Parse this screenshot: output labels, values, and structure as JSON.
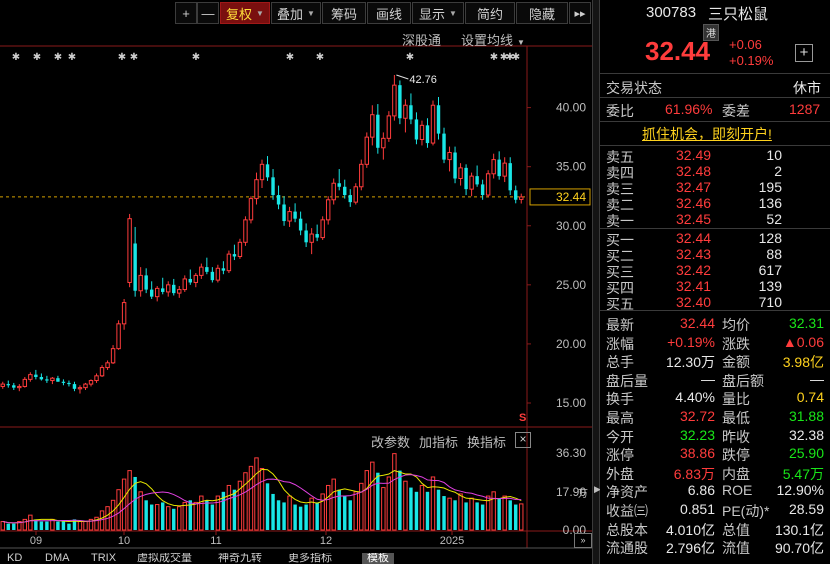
{
  "toolbar": {
    "buttons": [
      "+",
      "—",
      "复权",
      "叠加",
      "筹码",
      "画线",
      "显示",
      "简约",
      "隐藏"
    ],
    "more": "▸▸",
    "sub_links": [
      "深股通",
      "设置均线"
    ]
  },
  "chart_data": [
    {
      "type": "candlestick",
      "title": "",
      "x_tick_labels": [
        "09",
        "10",
        "11",
        "12",
        "2025"
      ],
      "y_ticks": [
        "40.00",
        "35.00",
        "30.00",
        "25.00",
        "20.00",
        "15.00"
      ],
      "ylim": [
        15,
        42.76
      ],
      "current_price_label": "32.44",
      "max_annotation": "42.76",
      "candles": [
        [
          16.4,
          16.8,
          16.2,
          16.6
        ],
        [
          16.6,
          16.9,
          16.3,
          16.5
        ],
        [
          16.5,
          16.7,
          16.1,
          16.3
        ],
        [
          16.3,
          16.6,
          16.0,
          16.4
        ],
        [
          16.4,
          17.2,
          16.3,
          17.0
        ],
        [
          17.0,
          17.6,
          16.8,
          17.4
        ],
        [
          17.4,
          17.8,
          17.0,
          17.2
        ],
        [
          17.2,
          17.5,
          16.9,
          17.0
        ],
        [
          17.0,
          17.3,
          16.7,
          16.9
        ],
        [
          16.9,
          17.2,
          16.6,
          17.1
        ],
        [
          17.1,
          17.3,
          16.8,
          16.8
        ],
        [
          16.8,
          17.0,
          16.5,
          16.7
        ],
        [
          16.7,
          16.9,
          16.4,
          16.6
        ],
        [
          16.6,
          16.8,
          16.0,
          16.2
        ],
        [
          16.2,
          16.5,
          15.8,
          16.3
        ],
        [
          16.3,
          16.7,
          16.1,
          16.6
        ],
        [
          16.6,
          17.0,
          16.4,
          16.9
        ],
        [
          16.9,
          17.5,
          16.7,
          17.3
        ],
        [
          17.3,
          18.2,
          17.2,
          18.0
        ],
        [
          18.0,
          18.6,
          17.8,
          18.4
        ],
        [
          18.4,
          19.9,
          18.3,
          19.6
        ],
        [
          19.6,
          22.0,
          19.5,
          21.7
        ],
        [
          21.7,
          23.8,
          21.2,
          23.5
        ],
        [
          25.2,
          31.0,
          24.8,
          30.6
        ],
        [
          28.5,
          29.9,
          24.0,
          24.5
        ],
        [
          24.5,
          26.5,
          24.0,
          25.8
        ],
        [
          25.8,
          26.4,
          24.3,
          24.6
        ],
        [
          24.6,
          25.3,
          23.8,
          24.0
        ],
        [
          24.0,
          24.9,
          23.6,
          24.7
        ],
        [
          24.7,
          25.6,
          24.2,
          24.4
        ],
        [
          24.4,
          25.3,
          24.0,
          25.0
        ],
        [
          25.0,
          25.5,
          24.1,
          24.3
        ],
        [
          24.3,
          24.9,
          23.9,
          24.6
        ],
        [
          24.6,
          25.8,
          24.4,
          25.5
        ],
        [
          25.5,
          26.3,
          25.0,
          25.2
        ],
        [
          25.2,
          26.0,
          24.8,
          25.8
        ],
        [
          25.8,
          26.8,
          25.5,
          26.5
        ],
        [
          26.5,
          27.3,
          25.9,
          26.1
        ],
        [
          26.1,
          26.5,
          25.2,
          25.4
        ],
        [
          25.4,
          26.7,
          25.2,
          26.4
        ],
        [
          26.4,
          27.0,
          25.9,
          26.2
        ],
        [
          26.2,
          27.9,
          26.0,
          27.6
        ],
        [
          27.6,
          28.4,
          27.1,
          27.4
        ],
        [
          27.4,
          28.9,
          27.2,
          28.6
        ],
        [
          28.6,
          30.8,
          28.3,
          30.5
        ],
        [
          30.5,
          32.5,
          30.2,
          32.3
        ],
        [
          32.3,
          34.5,
          31.8,
          33.9
        ],
        [
          33.9,
          35.6,
          33.2,
          35.2
        ],
        [
          35.2,
          35.9,
          33.8,
          34.1
        ],
        [
          34.1,
          34.8,
          32.2,
          32.6
        ],
        [
          32.6,
          33.4,
          31.4,
          31.8
        ],
        [
          31.8,
          32.5,
          30.0,
          30.4
        ],
        [
          30.4,
          31.6,
          29.9,
          31.2
        ],
        [
          31.2,
          31.9,
          30.3,
          30.6
        ],
        [
          30.6,
          31.2,
          29.2,
          29.6
        ],
        [
          29.6,
          30.2,
          28.2,
          28.6
        ],
        [
          28.6,
          29.8,
          27.6,
          29.3
        ],
        [
          29.3,
          30.1,
          28.7,
          29.0
        ],
        [
          29.0,
          30.8,
          28.8,
          30.5
        ],
        [
          30.5,
          32.5,
          30.1,
          32.2
        ],
        [
          32.2,
          34.0,
          31.8,
          33.6
        ],
        [
          33.6,
          34.8,
          33.0,
          33.3
        ],
        [
          33.3,
          33.9,
          32.3,
          32.6
        ],
        [
          32.6,
          33.1,
          31.6,
          32.0
        ],
        [
          32.0,
          33.6,
          31.8,
          33.3
        ],
        [
          33.3,
          35.6,
          33.0,
          35.2
        ],
        [
          35.2,
          37.9,
          34.9,
          37.5
        ],
        [
          37.5,
          40.2,
          36.8,
          39.4
        ],
        [
          39.4,
          40.3,
          36.1,
          36.6
        ],
        [
          36.6,
          37.9,
          35.6,
          37.4
        ],
        [
          37.4,
          39.7,
          37.1,
          39.3
        ],
        [
          39.3,
          42.76,
          38.9,
          41.9
        ],
        [
          41.9,
          42.3,
          38.6,
          39.1
        ],
        [
          39.1,
          40.7,
          37.9,
          40.2
        ],
        [
          40.2,
          41.2,
          38.6,
          39.0
        ],
        [
          39.0,
          39.6,
          36.9,
          37.3
        ],
        [
          37.3,
          38.9,
          36.8,
          38.5
        ],
        [
          38.5,
          39.1,
          36.6,
          37.0
        ],
        [
          37.0,
          40.6,
          36.8,
          40.2
        ],
        [
          40.2,
          40.9,
          37.3,
          37.8
        ],
        [
          37.8,
          38.3,
          35.3,
          35.6
        ],
        [
          35.6,
          36.7,
          34.6,
          36.2
        ],
        [
          36.2,
          36.7,
          33.6,
          34.0
        ],
        [
          34.0,
          35.3,
          33.4,
          34.9
        ],
        [
          34.9,
          35.2,
          32.6,
          33.1
        ],
        [
          33.1,
          34.5,
          32.5,
          34.2
        ],
        [
          34.2,
          35.1,
          33.3,
          33.5
        ],
        [
          33.5,
          33.9,
          32.2,
          32.6
        ],
        [
          32.6,
          34.7,
          32.4,
          34.4
        ],
        [
          34.4,
          36.1,
          34.0,
          35.6
        ],
        [
          35.6,
          36.3,
          33.9,
          34.2
        ],
        [
          34.2,
          35.8,
          33.7,
          35.3
        ],
        [
          35.3,
          35.8,
          32.6,
          33.0
        ],
        [
          33.0,
          33.4,
          31.9,
          32.2
        ],
        [
          32.23,
          32.72,
          31.88,
          32.44
        ]
      ],
      "volume_y_ticks": [
        "36.30",
        "17.90",
        "0.00"
      ],
      "volume_unit_label": "万",
      "volume_values": [
        4,
        3,
        3,
        4,
        5,
        7,
        5,
        4,
        4,
        5,
        4,
        4,
        3,
        5,
        4,
        4,
        5,
        6,
        9,
        11,
        14,
        19,
        24,
        28,
        25,
        18,
        14,
        12,
        12,
        13,
        11,
        10,
        11,
        13,
        14,
        13,
        16,
        14,
        12,
        16,
        18,
        21,
        19,
        23,
        27,
        30,
        34,
        29,
        22,
        17,
        14,
        13,
        16,
        12,
        11,
        12,
        15,
        13,
        17,
        21,
        24,
        19,
        16,
        14,
        18,
        22,
        28,
        32,
        27,
        20,
        25,
        36,
        28,
        23,
        20,
        18,
        21,
        18,
        25,
        19,
        16,
        15,
        14,
        17,
        13,
        15,
        13,
        12,
        16,
        18,
        15,
        16,
        14,
        12,
        12.3
      ]
    }
  ],
  "indicator_bar": {
    "labels": [
      "改参数",
      "加指标",
      "换指标"
    ],
    "close": "×"
  },
  "bottom_tabs": [
    "KD",
    "DMA",
    "TRIX",
    "虚拟成交量",
    "神奇九转",
    "更多指标",
    "模板"
  ],
  "bottom_tabs_active": 6,
  "stock": {
    "code": "300783",
    "name": "三只松鼠",
    "market_badge": "港",
    "price": "32.44",
    "change": "+0.06",
    "change_pct": "+0.19%",
    "add_btn": "+"
  },
  "status": {
    "label": "交易状态",
    "value": "休市"
  },
  "commission": {
    "ratio_label": "委比",
    "ratio": "61.96%",
    "diff_label": "委差",
    "diff": "1287"
  },
  "promo": "抓住机会，即刻开户!",
  "asks": [
    {
      "label": "卖五",
      "price": "32.49",
      "vol": "10"
    },
    {
      "label": "卖四",
      "price": "32.48",
      "vol": "2"
    },
    {
      "label": "卖三",
      "price": "32.47",
      "vol": "195"
    },
    {
      "label": "卖二",
      "price": "32.46",
      "vol": "136"
    },
    {
      "label": "卖一",
      "price": "32.45",
      "vol": "52"
    }
  ],
  "bids": [
    {
      "label": "买一",
      "price": "32.44",
      "vol": "128"
    },
    {
      "label": "买二",
      "price": "32.43",
      "vol": "88"
    },
    {
      "label": "买三",
      "price": "32.42",
      "vol": "617"
    },
    {
      "label": "买四",
      "price": "32.41",
      "vol": "139"
    },
    {
      "label": "买五",
      "price": "32.40",
      "vol": "710"
    }
  ],
  "stats": [
    {
      "l1": "最新",
      "v1": "32.44",
      "c1": "red",
      "l2": "均价",
      "v2": "32.31",
      "c2": "green"
    },
    {
      "l1": "涨幅",
      "v1": "+0.19%",
      "c1": "red",
      "l2": "涨跌",
      "v2": "▲0.06",
      "c2": "red"
    },
    {
      "l1": "总手",
      "v1": "12.30万",
      "c1": "white",
      "l2": "金额",
      "v2": "3.98亿",
      "c2": "yellow"
    },
    {
      "l1": "盘后量",
      "v1": "—",
      "c1": "white",
      "l2": "盘后额",
      "v2": "—",
      "c2": "white"
    },
    {
      "l1": "换手",
      "v1": "4.40%",
      "c1": "white",
      "l2": "量比",
      "v2": "0.74",
      "c2": "yellow"
    },
    {
      "l1": "最高",
      "v1": "32.72",
      "c1": "red",
      "l2": "最低",
      "v2": "31.88",
      "c2": "green"
    },
    {
      "l1": "今开",
      "v1": "32.23",
      "c1": "green",
      "l2": "昨收",
      "v2": "32.38",
      "c2": "white"
    },
    {
      "l1": "涨停",
      "v1": "38.86",
      "c1": "red",
      "l2": "跌停",
      "v2": "25.90",
      "c2": "green"
    },
    {
      "l1": "外盘",
      "v1": "6.83万",
      "c1": "red",
      "l2": "内盘",
      "v2": "5.47万",
      "c2": "green"
    },
    {
      "l1": "净资产",
      "v1": "6.86",
      "c1": "white",
      "l2": "ROE",
      "v2": "12.90%",
      "c2": "white"
    },
    {
      "l1": "收益㈢",
      "v1": "0.851",
      "c1": "white",
      "l2": "PE(动)*",
      "v2": "28.59",
      "c2": "white"
    },
    {
      "l1": "总股本",
      "v1": "4.010亿",
      "c1": "white",
      "l2": "总值",
      "v2": "130.1亿",
      "c2": "white"
    },
    {
      "l1": "流通股",
      "v1": "2.796亿",
      "c1": "white",
      "l2": "流值",
      "v2": "90.70亿",
      "c2": "white"
    }
  ],
  "colors": {
    "up": "#ff3c3c",
    "down": "#19e6e6",
    "ma_yellow": "#e8e800",
    "ma_magenta": "#e040e0",
    "accent": "#ffd21e"
  }
}
